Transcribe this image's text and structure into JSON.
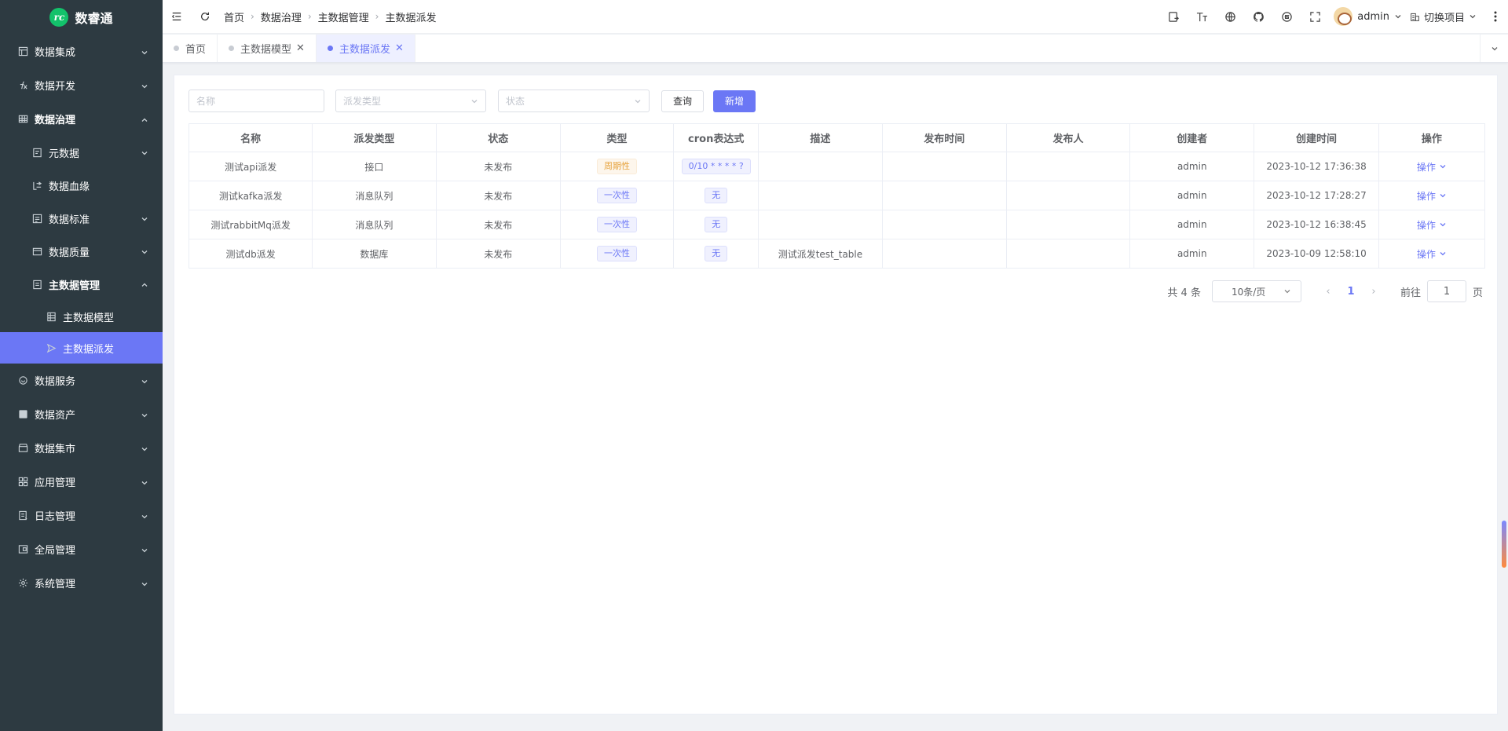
{
  "app": {
    "title": "数睿通"
  },
  "sidebar": {
    "items": [
      {
        "label": "数据集成",
        "icon": "database-icon",
        "level": 0,
        "expanded": false
      },
      {
        "label": "数据开发",
        "icon": "fx-icon",
        "level": 0,
        "expanded": false
      },
      {
        "label": "数据治理",
        "icon": "grid-icon",
        "level": 0,
        "expanded": true
      },
      {
        "label": "元数据",
        "icon": "metadata-icon",
        "level": 1,
        "expanded": false
      },
      {
        "label": "数据血缘",
        "icon": "lineage-icon",
        "level": 1
      },
      {
        "label": "数据标准",
        "icon": "standard-icon",
        "level": 1,
        "expanded": false
      },
      {
        "label": "数据质量",
        "icon": "quality-icon",
        "level": 1,
        "expanded": false
      },
      {
        "label": "主数据管理",
        "icon": "masterdata-icon",
        "level": 1,
        "expanded": true
      },
      {
        "label": "主数据模型",
        "icon": "table-icon",
        "level": 2
      },
      {
        "label": "主数据派发",
        "icon": "send-icon",
        "level": 2,
        "active": true
      },
      {
        "label": "数据服务",
        "icon": "service-icon",
        "level": 0,
        "expanded": false
      },
      {
        "label": "数据资产",
        "icon": "asset-icon",
        "level": 0,
        "expanded": false
      },
      {
        "label": "数据集市",
        "icon": "market-icon",
        "level": 0,
        "expanded": false
      },
      {
        "label": "应用管理",
        "icon": "apps-icon",
        "level": 0,
        "expanded": false
      },
      {
        "label": "日志管理",
        "icon": "log-icon",
        "level": 0,
        "expanded": false
      },
      {
        "label": "全局管理",
        "icon": "global-icon",
        "level": 0,
        "expanded": false
      },
      {
        "label": "系统管理",
        "icon": "settings-icon",
        "level": 0,
        "expanded": false
      }
    ]
  },
  "header": {
    "breadcrumb": [
      "首页",
      "数据治理",
      "主数据管理",
      "主数据派发"
    ],
    "user": "admin",
    "project": "切换项目"
  },
  "tabs": [
    {
      "label": "首页",
      "closable": false,
      "active": false
    },
    {
      "label": "主数据模型",
      "closable": true,
      "active": false
    },
    {
      "label": "主数据派发",
      "closable": true,
      "active": true
    }
  ],
  "filters": {
    "name_placeholder": "名称",
    "type_placeholder": "派发类型",
    "status_placeholder": "状态",
    "query_label": "查询",
    "add_label": "新增"
  },
  "table": {
    "columns": [
      "名称",
      "派发类型",
      "状态",
      "类型",
      "cron表达式",
      "描述",
      "发布时间",
      "发布人",
      "创建者",
      "创建时间",
      "操作"
    ],
    "rows": [
      {
        "name": "测试api派发",
        "dist_type": "接口",
        "status": "未发布",
        "type": "周期性",
        "type_style": "warn",
        "cron": "0/10 * * * * ?",
        "desc": "",
        "pub_time": "",
        "publisher": "",
        "creator": "admin",
        "created": "2023-10-12 17:36:38",
        "op": "操作"
      },
      {
        "name": "测试kafka派发",
        "dist_type": "消息队列",
        "status": "未发布",
        "type": "一次性",
        "type_style": "info",
        "cron": "无",
        "desc": "",
        "pub_time": "",
        "publisher": "",
        "creator": "admin",
        "created": "2023-10-12 17:28:27",
        "op": "操作"
      },
      {
        "name": "测试rabbitMq派发",
        "dist_type": "消息队列",
        "status": "未发布",
        "type": "一次性",
        "type_style": "info",
        "cron": "无",
        "desc": "",
        "pub_time": "",
        "publisher": "",
        "creator": "admin",
        "created": "2023-10-12 16:38:45",
        "op": "操作"
      },
      {
        "name": "测试db派发",
        "dist_type": "数据库",
        "status": "未发布",
        "type": "一次性",
        "type_style": "info",
        "cron": "无",
        "desc": "测试派发test_table",
        "pub_time": "",
        "publisher": "",
        "creator": "admin",
        "created": "2023-10-09 12:58:10",
        "op": "操作"
      }
    ]
  },
  "pagination": {
    "total_text": "共 4 条",
    "page_size": "10条/页",
    "current_page": "1",
    "goto_label": "前往",
    "goto_value": "1",
    "page_suffix": "页"
  },
  "colors": {
    "primary": "#6b77f5",
    "sidebar_bg": "#2d3a41",
    "warn": "#e6a23c"
  }
}
